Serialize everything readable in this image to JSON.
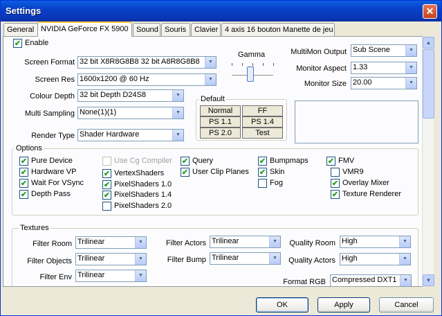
{
  "window": {
    "title": "Settings"
  },
  "tabs": [
    {
      "label": "General"
    },
    {
      "label": "NVIDIA GeForce FX 5900"
    },
    {
      "label": "Sound"
    },
    {
      "label": "Souris"
    },
    {
      "label": "Clavier"
    },
    {
      "label": "4 axis 16 bouton Manette de jeu"
    }
  ],
  "enable": {
    "label": "Enable",
    "checked": true
  },
  "display": {
    "screen_format": {
      "label": "Screen Format",
      "value": "32 bit X8R8G8B8 32 bit A8R8G8B8"
    },
    "screen_res": {
      "label": "Screen Res",
      "value": "1600x1200 @ 60 Hz"
    },
    "colour_depth": {
      "label": "Colour Depth",
      "value": "32 bit Depth D24S8"
    },
    "multi_sampling": {
      "label": "Multi Sampling",
      "value": "None(1)(1)"
    },
    "render_type": {
      "label": "Render Type",
      "value": "Shader Hardware"
    }
  },
  "gamma": {
    "label": "Gamma",
    "level": 0.5
  },
  "monitor": {
    "multimon_output": {
      "label": "MultiMon Output",
      "value": "Sub Scene"
    },
    "aspect": {
      "label": "Monitor Aspect",
      "value": "1.33"
    },
    "size": {
      "label": "Monitor Size",
      "value": "20.00"
    }
  },
  "default_group": {
    "title": "Default",
    "buttons": [
      "Normal",
      "FF",
      "PS 1.1",
      "PS 1.4",
      "PS 2.0",
      "Test"
    ]
  },
  "options": {
    "title": "Options",
    "items": [
      {
        "label": "Pure Device",
        "checked": true,
        "enabled": true
      },
      {
        "label": "Hardware VP",
        "checked": true,
        "enabled": true
      },
      {
        "label": "Wait For VSync",
        "checked": true,
        "enabled": true
      },
      {
        "label": "Depth Pass",
        "checked": true,
        "enabled": true
      },
      {
        "label": "Use Cg Compiler",
        "checked": false,
        "enabled": false
      },
      {
        "label": "VertexShaders",
        "checked": true,
        "enabled": true
      },
      {
        "label": "PixelShaders 1.0",
        "checked": true,
        "enabled": true
      },
      {
        "label": "PixelShaders 1.4",
        "checked": true,
        "enabled": true
      },
      {
        "label": "PixelShaders 2.0",
        "checked": false,
        "enabled": true
      },
      {
        "label": "Query",
        "checked": true,
        "enabled": true
      },
      {
        "label": "User Clip Planes",
        "checked": true,
        "enabled": true
      },
      {
        "label": "Bumpmaps",
        "checked": true,
        "enabled": true
      },
      {
        "label": "Skin",
        "checked": true,
        "enabled": true
      },
      {
        "label": "Fog",
        "checked": false,
        "enabled": true
      },
      {
        "label": "FMV",
        "checked": true,
        "enabled": true
      },
      {
        "label": "VMR9",
        "checked": false,
        "enabled": true
      },
      {
        "label": "Overlay Mixer",
        "checked": true,
        "enabled": true
      },
      {
        "label": "Texture Renderer",
        "checked": true,
        "enabled": true
      }
    ]
  },
  "textures": {
    "title": "Textures",
    "filter_room": {
      "label": "Filter Room",
      "value": "Trilinear"
    },
    "filter_objects": {
      "label": "Filter Objects",
      "value": "Trilinear"
    },
    "filter_env": {
      "label": "Filter Env",
      "value": "Trilinear"
    },
    "filter_actors": {
      "label": "Filter Actors",
      "value": "Trilinear"
    },
    "filter_bump": {
      "label": "Filter Bump",
      "value": "Trilinear"
    },
    "quality_room": {
      "label": "Quality Room",
      "value": "High"
    },
    "quality_actors": {
      "label": "Quality Actors",
      "value": "High"
    },
    "format_rgb": {
      "label": "Format RGB",
      "value": "Compressed DXT1"
    }
  },
  "buttons": {
    "ok": "OK",
    "apply": "Apply",
    "cancel": "Cancel"
  },
  "colors": {
    "titlebar": "#0a46cc",
    "tab_highlight": "#ffc83c",
    "check": "#21a121"
  }
}
